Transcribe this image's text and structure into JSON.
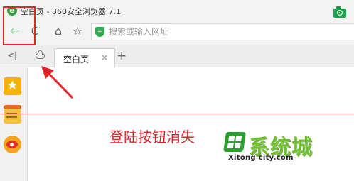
{
  "window": {
    "app_icon": "e",
    "title": "空白页 - 360安全浏览器 7.1",
    "camera_icon": "camera-icon"
  },
  "toolbar": {
    "back_icon": "←",
    "refresh_icon": "C",
    "home_icon": "⌂",
    "favorite_icon": "☆",
    "address_placeholder": "搜索或输入网址",
    "shield_icon": "+"
  },
  "tabs": {
    "sidebar_toggle": "<|",
    "items": [
      {
        "label": "空白页",
        "close": "×"
      }
    ],
    "new_tab": "+"
  },
  "sidebar": {
    "items": [
      {
        "name": "favorites",
        "icon": "★"
      },
      {
        "name": "notes",
        "icon": "notes-icon"
      },
      {
        "name": "weibo",
        "icon": "weibo-icon"
      }
    ]
  },
  "annotation": {
    "text": "登陆按钮消失",
    "color": "#d9232a"
  },
  "watermark": {
    "title": "系统城",
    "url": "Xitong city.com"
  }
}
